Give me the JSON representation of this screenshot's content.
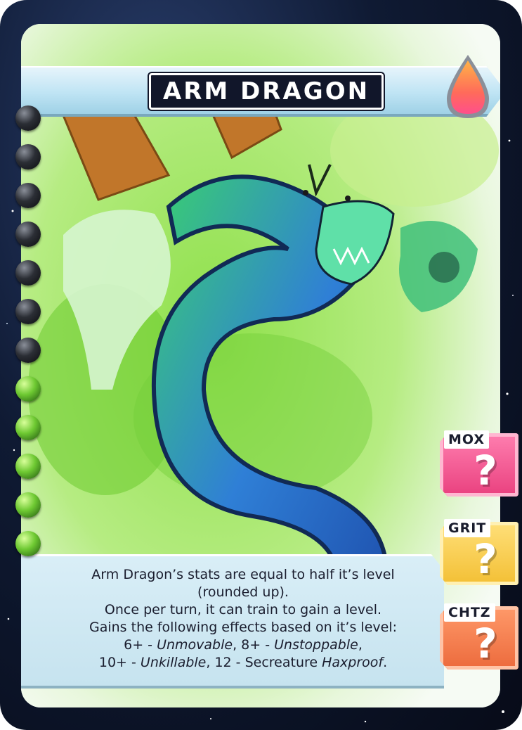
{
  "card": {
    "name": "ARM DRAGON",
    "element_icon": "fire-drop-icon",
    "ability_lines": [
      "Arm Dragon’s stats are equal to half it’s level",
      "(rounded up).",
      "Once per turn, it can train to gain a level.",
      "Gains the following effects based on it’s level:"
    ],
    "effects_line1": {
      "a_prefix": "6+ - ",
      "a_keyword": "Unmovable",
      "sep": ", 8+ - ",
      "b_keyword": "Unstoppable",
      "end": ","
    },
    "effects_line2": {
      "a_prefix": "10+ - ",
      "a_keyword": "Unkillable",
      "mid": ", 12 - Secreature ",
      "b_keyword": "Haxproof",
      "end": "."
    },
    "stats": {
      "mox": {
        "label": "MOX",
        "value": "?"
      },
      "grit": {
        "label": "GRIT",
        "value": "?"
      },
      "chtz": {
        "label": "CHTZ",
        "value": "?"
      }
    },
    "binder_rings": {
      "total": 12,
      "filled": 5
    },
    "colors": {
      "mox": "#e9407e",
      "grit": "#f3bf34",
      "chtz": "#ec6a3c",
      "art_green": "#7fd13b",
      "dragon_blue": "#2f6fd0"
    }
  }
}
